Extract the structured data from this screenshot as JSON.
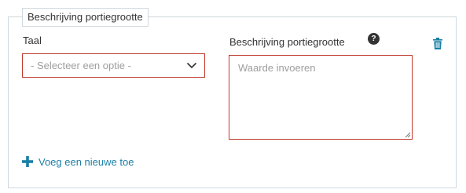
{
  "section": {
    "legend": "Beschrijving portiegrootte"
  },
  "language_field": {
    "label": "Taal",
    "selected": "- Selecteer een optie -",
    "icon": "chevron-down-icon"
  },
  "description_field": {
    "label": "Beschrijving portiegrootte",
    "help_icon_text": "?",
    "placeholder": "Waarde invoeren",
    "value": ""
  },
  "actions": {
    "delete_icon": "trash-icon",
    "add_label": "Voeg een nieuwe toe",
    "add_icon": "plus-icon"
  },
  "colors": {
    "accent": "#1a7fa6",
    "error_border": "#c0392b",
    "border": "#cfd8dc",
    "placeholder": "#9e9e9e"
  }
}
